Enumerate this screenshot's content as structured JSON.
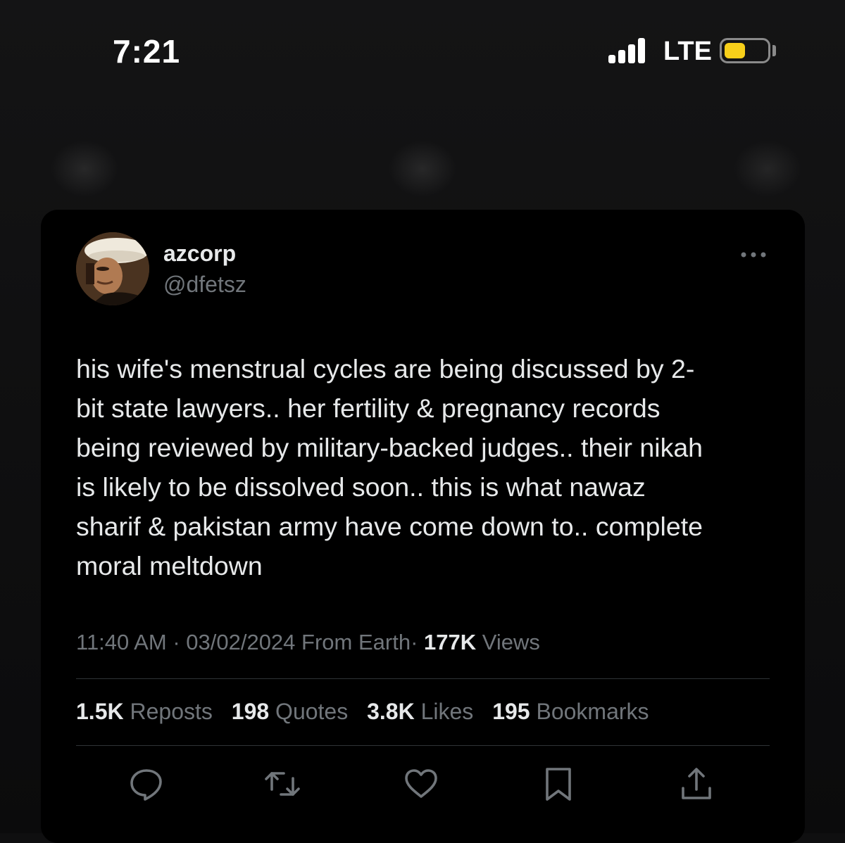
{
  "status_bar": {
    "time": "7:21",
    "network": "LTE",
    "battery_level": 0.5,
    "icons": [
      "signal-icon",
      "battery-icon"
    ],
    "battery_color": "#f7cf1a"
  },
  "tweet": {
    "display_name": "azcorp",
    "handle": "@dfetsz",
    "text": "his wife's menstrual cycles are being discussed by 2-\nbit state lawyers.. her fertility & pregnancy records\nbeing reviewed by military-backed judges.. their nikah\nis likely to be dissolved soon.. this is what nawaz\nsharif & pakistan army have come down to.. complete\nmoral meltdown",
    "meta": {
      "time": "11:40 AM",
      "separator": "·",
      "date": "03/02/2024",
      "source": "From Earth",
      "views_count": "177K",
      "views_label": "Views"
    },
    "stats": [
      {
        "count": "1.5K",
        "label": "Reposts"
      },
      {
        "count": "198",
        "label": "Quotes"
      },
      {
        "count": "3.8K",
        "label": "Likes"
      },
      {
        "count": "195",
        "label": "Bookmarks"
      }
    ],
    "actions": [
      "reply-icon",
      "retweet-icon",
      "like-icon",
      "bookmark-icon",
      "share-icon"
    ]
  },
  "colors": {
    "text_primary": "#e7e9ea",
    "text_secondary": "#71767b",
    "card_background": "#000000",
    "divider": "#2f3336"
  }
}
